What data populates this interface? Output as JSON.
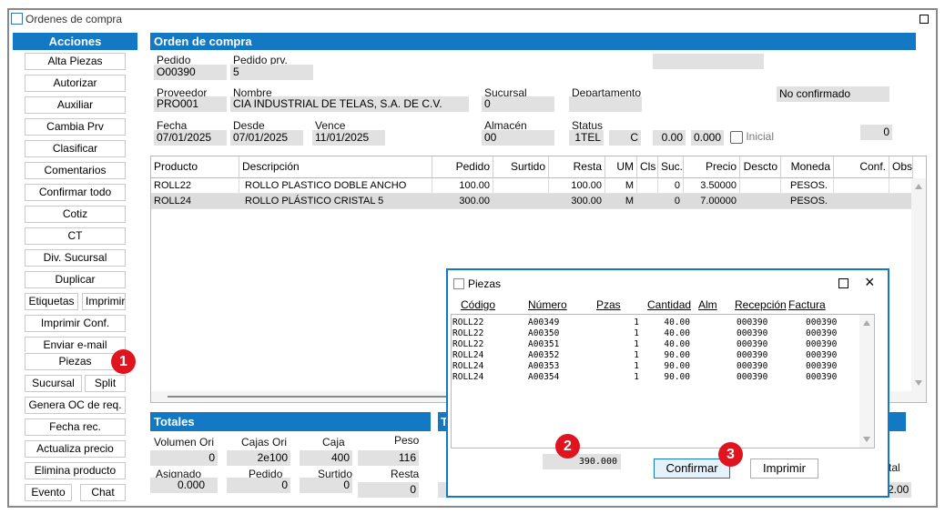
{
  "window": {
    "title": "Ordenes de compra"
  },
  "acciones": {
    "title": "Acciones",
    "buttons": [
      "Alta Piezas",
      "Autorizar",
      "Auxiliar",
      "Cambia Prv",
      "Clasificar",
      "Comentarios",
      "Confirmar todo",
      "Cotiz",
      "CT",
      "Div. Sucursal",
      "Duplicar"
    ],
    "etiquetas": "Etiquetas",
    "imprimir": "Imprimir",
    "imprimir_conf": "Imprimir Conf.",
    "enviar_email": "Enviar e-mail",
    "piezas": "Piezas",
    "sucursal": "Sucursal",
    "split": "Split",
    "genera_oc": "Genera OC de req.",
    "fecha_rec": "Fecha rec.",
    "actualiza_precio": "Actualiza precio",
    "elimina_producto": "Elimina producto",
    "evento": "Evento",
    "chat": "Chat"
  },
  "orden": {
    "title": "Orden de compra",
    "pedido_label": "Pedido",
    "pedido": "O00390",
    "pedido_prv_label": "Pedido prv.",
    "pedido_prv": "5",
    "proveedor_label": "Proveedor",
    "proveedor": "PRO001",
    "nombre_label": "Nombre",
    "nombre": "CIA INDUSTRIAL DE TELAS, S.A. DE C.V.",
    "sucursal_label": "Sucursal",
    "sucursal": "0",
    "departamento_label": "Departamento",
    "departamento": "",
    "estado": "No confirmado",
    "fecha_label": "Fecha",
    "fecha": "07/01/2025",
    "desde_label": "Desde",
    "desde": "07/01/2025",
    "vence_label": "Vence",
    "vence": "11/01/2025",
    "almacen_label": "Almacén",
    "almacen": "00",
    "status_label": "Status",
    "status": "1TEL",
    "status_c": "C",
    "val1": "0.00",
    "val2": "0.000",
    "inicial_label": "Inicial",
    "right_val": "0"
  },
  "grid": {
    "headers": [
      "Producto",
      "Descripción",
      "Pedido",
      "Surtido",
      "Resta",
      "UM",
      "Cls",
      "Suc.",
      "Precio",
      "Descto",
      "Moneda",
      "Conf.",
      "Obs."
    ],
    "rows": [
      {
        "producto": "ROLL22",
        "descripcion": "ROLLO PLASTICO DOBLE ANCHO",
        "pedido": "100.00",
        "surtido": "",
        "resta": "100.00",
        "um": "M",
        "cls": "",
        "suc": "0",
        "precio": "3.50000",
        "descto": "",
        "moneda": "PESOS.",
        "conf": "",
        "obs": ""
      },
      {
        "producto": "ROLL24",
        "descripcion": "ROLLO PLÁSTICO CRISTAL 5",
        "pedido": "300.00",
        "surtido": "",
        "resta": "300.00",
        "um": "M",
        "cls": "",
        "suc": "0",
        "precio": "7.00000",
        "descto": "",
        "moneda": "PESOS.",
        "conf": "",
        "obs": ""
      }
    ]
  },
  "totales": {
    "title": "Totales",
    "volumen_ori_label": "Volumen Ori",
    "volumen_ori": "0",
    "cajas_ori_label": "Cajas Ori",
    "cajas_ori": "2e100",
    "caja_label": "Caja",
    "caja": "400",
    "peso_label": "Peso",
    "peso": "116",
    "asignado_label": "Asignado",
    "asignado": "0.000",
    "pedido_label": "Pedido",
    "pedido": "0",
    "surtido_label": "Surtido",
    "surtido": "0",
    "resta_label": "Resta",
    "resta": "0",
    "right_label_partial": "tal",
    "right_value_partial": "2.00",
    "hidden_header_partial": "T"
  },
  "piezas_dialog": {
    "title": "Piezas",
    "headers": [
      "Código",
      "Número",
      "Pzas",
      "Cantidad",
      "Alm",
      "Recepción",
      "Factura"
    ],
    "rows": [
      {
        "codigo": "ROLL22",
        "numero": "A00349",
        "pzas": "1",
        "cantidad": "40.00",
        "alm": "",
        "recepcion": "000390",
        "factura": "000390"
      },
      {
        "codigo": "ROLL22",
        "numero": "A00350",
        "pzas": "1",
        "cantidad": "40.00",
        "alm": "",
        "recepcion": "000390",
        "factura": "000390"
      },
      {
        "codigo": "ROLL22",
        "numero": "A00351",
        "pzas": "1",
        "cantidad": "40.00",
        "alm": "",
        "recepcion": "000390",
        "factura": "000390"
      },
      {
        "codigo": "ROLL24",
        "numero": "A00352",
        "pzas": "1",
        "cantidad": "90.00",
        "alm": "",
        "recepcion": "000390",
        "factura": "000390"
      },
      {
        "codigo": "ROLL24",
        "numero": "A00353",
        "pzas": "1",
        "cantidad": "90.00",
        "alm": "",
        "recepcion": "000390",
        "factura": "000390"
      },
      {
        "codigo": "ROLL24",
        "numero": "A00354",
        "pzas": "1",
        "cantidad": "90.00",
        "alm": "",
        "recepcion": "000390",
        "factura": "000390"
      }
    ],
    "total": "390.000",
    "confirmar": "Confirmar",
    "imprimir": "Imprimir"
  },
  "markers": [
    "1",
    "2",
    "3"
  ],
  "colors": {
    "accent": "#1479c4",
    "marker": "#e0141e",
    "field": "#e1e1e1"
  }
}
